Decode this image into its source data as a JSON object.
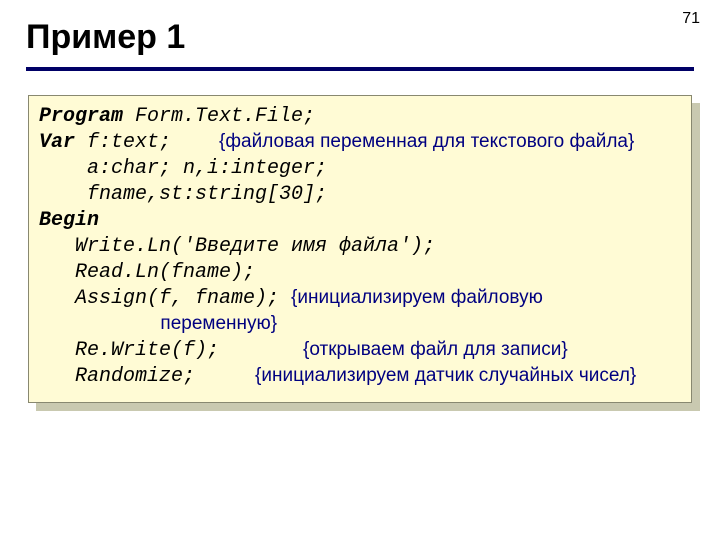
{
  "page_number": "71",
  "title": "Пример 1",
  "code": {
    "l1a": "Program",
    "l1b": " Form.Text.File;",
    "l2a": "Var",
    "l2b": " f:text;    ",
    "c2": "{файловая переменная для текстового файла}",
    "l3": "    a:char; n,i:integer;",
    "l4": "    fname,st:string[30];",
    "l5": "Begin",
    "l6": "   Write.Ln('Введите имя файла');",
    "l7": "   Read.Ln(fname);",
    "l8": "   Assign(f, fname); ",
    "c8": "{инициализируем файловую",
    "c8b": "                       переменную}",
    "l9": "   Re.Write(f);       ",
    "c9": "{открываем файл для записи}",
    "l10": "   Randomize;     ",
    "c10": "{инициализируем датчик случайных чисел}"
  }
}
